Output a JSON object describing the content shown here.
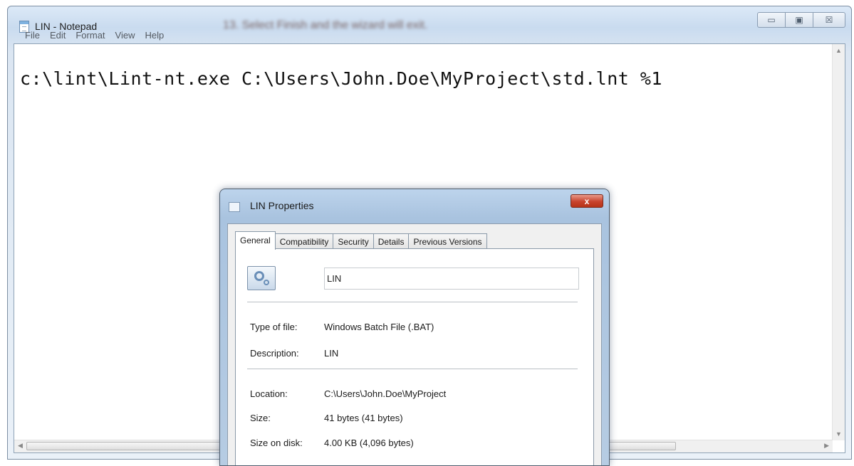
{
  "notepad": {
    "title": "LIN - Notepad",
    "blurred_caption": "13. Select Finish and the wizard will exit.",
    "window_buttons": {
      "minimize": "▭",
      "maximize": "▣",
      "close": "☒"
    },
    "menu": [
      "File",
      "Edit",
      "Format",
      "View",
      "Help"
    ],
    "content": "c:\\lint\\Lint-nt.exe C:\\Users\\John.Doe\\MyProject\\std.lnt %1",
    "scroll_arrows": {
      "up": "▲",
      "down": "▼",
      "left": "◀",
      "right": "▶"
    }
  },
  "dialog": {
    "title": "LIN Properties",
    "close_symbol": "x",
    "tabs": [
      "General",
      "Compatibility",
      "Security",
      "Details",
      "Previous Versions"
    ],
    "active_tab": "General",
    "file_name": "LIN",
    "properties": [
      {
        "label": "Type of file:",
        "value": "Windows Batch File (.BAT)"
      },
      {
        "label": "Description:",
        "value": "LIN"
      },
      {
        "label": "Location:",
        "value": "C:\\Users\\John.Doe\\MyProject"
      },
      {
        "label": "Size:",
        "value": "41 bytes (41 bytes)"
      },
      {
        "label": "Size on disk:",
        "value": "4.00 KB (4,096 bytes)"
      }
    ]
  }
}
